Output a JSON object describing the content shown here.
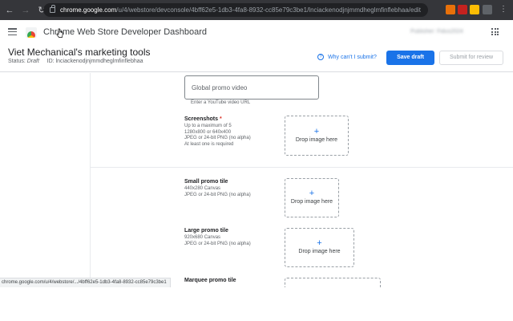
{
  "browser": {
    "url_host": "chrome.google.com",
    "url_rest": "/u/4/webstore/devconsole/4bff62e5-1db3-4fa8-8932-cc85e79c3be1/lnciackenodjnjmmdheglmfinflebhaa/edit",
    "ext_colors": [
      "#e8710a",
      "#c5221f",
      "#fbbc04",
      "#5f6368"
    ]
  },
  "header": {
    "title": "Chrome Web Store Developer Dashboard",
    "publisher": "Publisher: Fidus2024"
  },
  "item": {
    "name": "Viet Mechanical's marketing tools",
    "status_label": "Status:",
    "status_value": "Draft",
    "id_label": "ID:",
    "id_value": "lnciackenodjnjmmdheglmfinflebhaa",
    "help_link": "Why can't I submit?",
    "save_label": "Save draft",
    "submit_label": "Submit for review"
  },
  "promo_video": {
    "placeholder": "Global promo video",
    "helper": "Enter a YouTube video URL"
  },
  "screenshots": {
    "label": "Screenshots",
    "required_mark": "*",
    "desc": "Up to a maximum of 5\n1280x800 or 640x400\nJPEG or 24-bit PNG (no alpha)\nAt least one is required",
    "drop_text": "Drop image here"
  },
  "small_tile": {
    "label": "Small promo tile",
    "desc": "440x280 Canvas\nJPEG or 24-bit PNG (no alpha)",
    "drop_text": "Drop image here"
  },
  "large_tile": {
    "label": "Large promo tile",
    "desc": "920x680 Canvas\nJPEG or 24-bit PNG (no alpha)",
    "drop_text": "Drop image here"
  },
  "marquee_tile": {
    "label": "Marquee promo tile"
  },
  "status_bar": {
    "text": "chrome.google.com/u/4/webstore/.../4bff62e5-1db3-4fa8-8932-cc85e79c3be1"
  },
  "icons": {
    "plus": "+",
    "question": "?"
  }
}
